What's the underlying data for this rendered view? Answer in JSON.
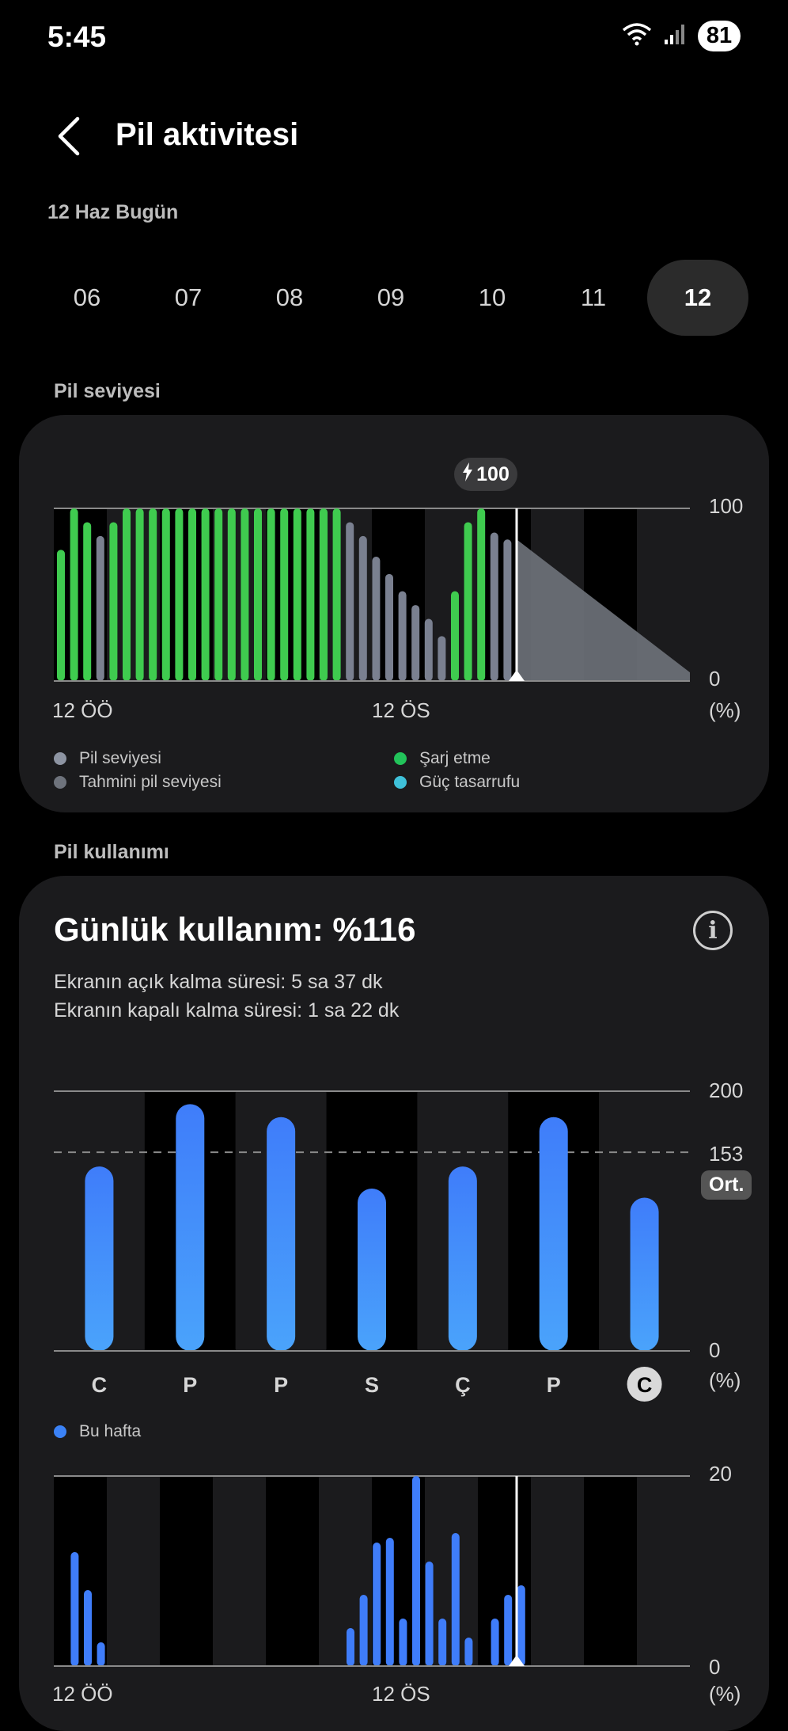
{
  "status_bar": {
    "time": "5:45",
    "battery": "81"
  },
  "header": {
    "title": "Pil aktivitesi",
    "subtitle": "12 Haz Bugün"
  },
  "days": [
    {
      "label": "06",
      "selected": false
    },
    {
      "label": "07",
      "selected": false
    },
    {
      "label": "08",
      "selected": false
    },
    {
      "label": "09",
      "selected": false
    },
    {
      "label": "10",
      "selected": false
    },
    {
      "label": "11",
      "selected": false
    },
    {
      "label": "12",
      "selected": true
    }
  ],
  "battery_level": {
    "section_label": "Pil seviyesi",
    "charge_badge": "100",
    "y_top": "100",
    "y_bottom": "0",
    "unit": "(%)",
    "x_start": "12 ÖÖ",
    "x_mid": "12 ÖS",
    "legend": [
      {
        "label": "Pil seviyesi",
        "color": "#8d94a2"
      },
      {
        "label": "Tahmini pil seviyesi",
        "color": "#6e737c"
      },
      {
        "label": "Şarj etme",
        "color": "#22c35a"
      },
      {
        "label": "Güç tasarrufu",
        "color": "#3fc1d9"
      }
    ]
  },
  "usage": {
    "section_label": "Pil kullanımı",
    "title": "Günlük kullanım: %116",
    "screen_on": "Ekranın açık kalma süresi: 5 sa 37 dk",
    "screen_off": "Ekranın kapalı kalma süresi: 1 sa 22 dk",
    "y_top": "200",
    "y_avg": "153",
    "y_bottom": "0",
    "avg_label": "Ort.",
    "unit": "(%)",
    "legend": "Bu hafta",
    "hourly_y_top": "20",
    "hourly_y_bottom": "0",
    "hourly_x_start": "12 ÖÖ",
    "hourly_x_mid": "12 ÖS",
    "hourly_unit": "(%)"
  },
  "chart_data": [
    {
      "type": "bar",
      "title": "Pil seviyesi",
      "ylim": [
        0,
        100
      ],
      "x_ticks": [
        "12 ÖÖ",
        "12 ÖS"
      ],
      "series": [
        {
          "name": "Pil seviyesi",
          "values": [
            76,
            100,
            92,
            84,
            92,
            100,
            100,
            100,
            100,
            100,
            100,
            100,
            100,
            100,
            100,
            100,
            100,
            100,
            100,
            100,
            100,
            100,
            92,
            84,
            72,
            62,
            52,
            44,
            36,
            26,
            52,
            92,
            100,
            86,
            82
          ]
        },
        {
          "name": "Şarj etme",
          "charging": [
            true,
            true,
            true,
            false,
            true,
            true,
            true,
            true,
            true,
            true,
            true,
            true,
            true,
            true,
            true,
            true,
            true,
            true,
            true,
            true,
            true,
            true,
            false,
            false,
            false,
            false,
            false,
            false,
            false,
            false,
            true,
            true,
            true,
            false,
            false
          ]
        }
      ],
      "forecast": {
        "from": 82,
        "to": 5
      }
    },
    {
      "type": "bar",
      "title": "Günlük kullanım",
      "categories": [
        "C",
        "P",
        "P",
        "S",
        "Ç",
        "P",
        "C"
      ],
      "values": [
        142,
        190,
        180,
        125,
        142,
        180,
        118
      ],
      "average": 153,
      "ylim": [
        0,
        200
      ],
      "series_name": "Bu hafta"
    },
    {
      "type": "bar",
      "title": "Saatlik kullanım",
      "ylim": [
        0,
        20
      ],
      "values": [
        12,
        8,
        2.5,
        0,
        0,
        0,
        0,
        0,
        0,
        0,
        0,
        0,
        0,
        0,
        0,
        0,
        0,
        0,
        0,
        0,
        0,
        4,
        7.5,
        13,
        13.5,
        5,
        20,
        11,
        5,
        14,
        3,
        0,
        5,
        7.5,
        8.5
      ]
    }
  ]
}
